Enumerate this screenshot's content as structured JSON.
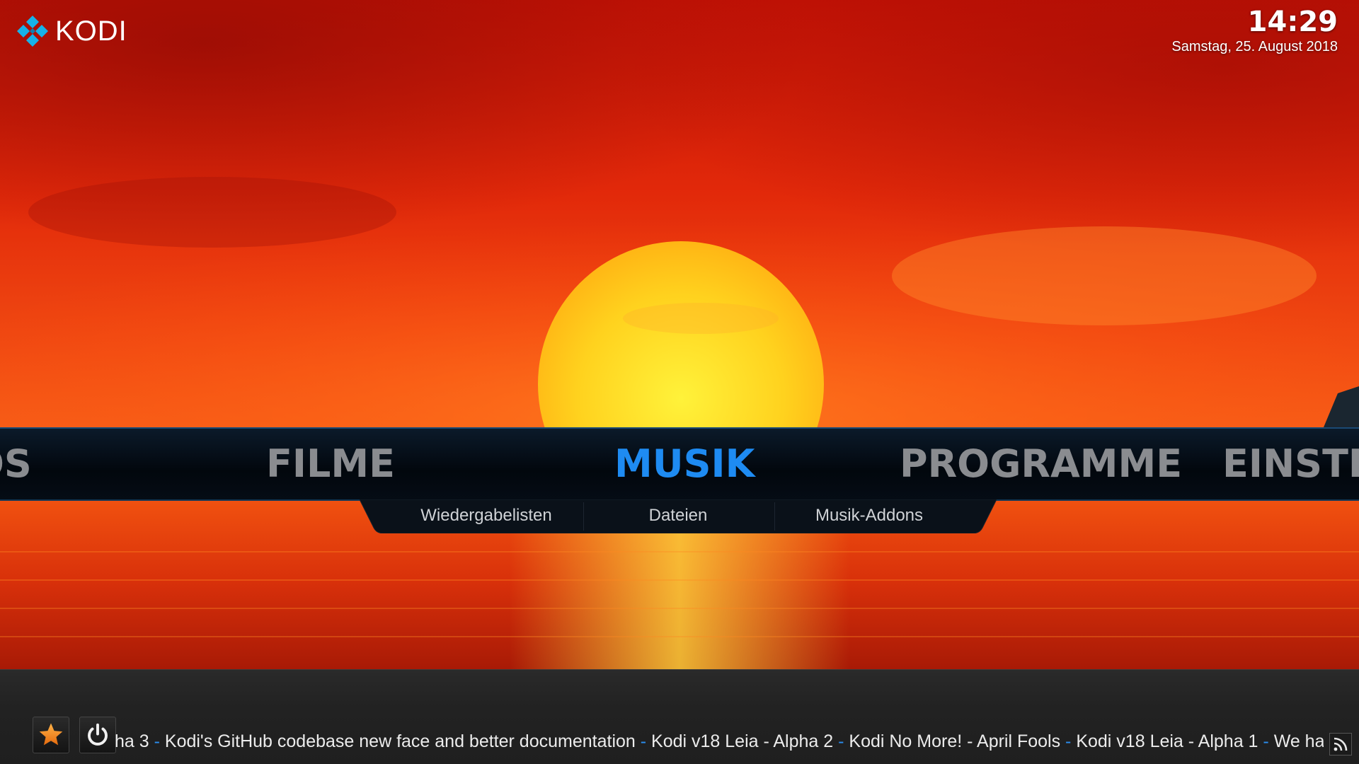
{
  "app": {
    "logo_text": "KODI"
  },
  "clock": {
    "time": "14:29",
    "date": "Samstag, 25. August 2018"
  },
  "main_menu": {
    "items": [
      {
        "label": "OS",
        "state": "partial-left"
      },
      {
        "label": "FILME",
        "state": "normal"
      },
      {
        "label": "MUSIK",
        "state": "active"
      },
      {
        "label": "PROGRAMME",
        "state": "normal"
      },
      {
        "label": "EINSTE",
        "state": "partial-right"
      }
    ]
  },
  "sub_menu": {
    "items": [
      {
        "label": "Wiedergabelisten"
      },
      {
        "label": "Dateien"
      },
      {
        "label": "Musik-Addons"
      }
    ]
  },
  "footer": {
    "buttons": [
      {
        "icon": "star-icon"
      },
      {
        "icon": "power-icon"
      }
    ],
    "ticker": [
      "ha 3",
      "Kodi's GitHub codebase new face and better documentation",
      "Kodi v18 Leia - Alpha 2",
      "Kodi No More! - April Fools",
      "Kodi v18 Leia - Alpha 1",
      "We have"
    ],
    "ticker_separator": " - ",
    "rss_icon": "rss-icon"
  },
  "colors": {
    "accent": "#1e8bf2",
    "menu_inactive": "#8a8c90"
  }
}
